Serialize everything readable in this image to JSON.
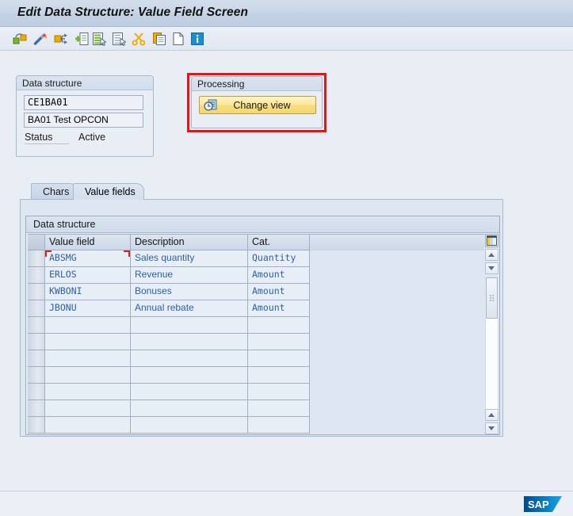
{
  "window": {
    "title": "Edit Data Structure: Value Field Screen"
  },
  "toolbar": {
    "buttons": [
      {
        "name": "structure-link-icon",
        "tooltip": "Structure"
      },
      {
        "name": "magic-wand-icon",
        "tooltip": "Generate"
      },
      {
        "name": "transport-arrow-icon",
        "tooltip": "Transport"
      },
      {
        "name": "insert-line-icon",
        "tooltip": "Insert line"
      },
      {
        "name": "select-list-icon",
        "tooltip": "Select"
      },
      {
        "name": "deselect-list-icon",
        "tooltip": "Deselect"
      },
      {
        "name": "cut-scissors-icon",
        "tooltip": "Cut"
      },
      {
        "name": "copy-icon",
        "tooltip": "Copy"
      },
      {
        "name": "new-document-icon",
        "tooltip": "Paste"
      },
      {
        "name": "info-icon",
        "tooltip": "Information"
      }
    ]
  },
  "data_structure_panel": {
    "header": "Data structure",
    "structure_name": "CE1BA01",
    "structure_description": "BA01 Test OPCON",
    "status_label": "Status",
    "status_value": "Active"
  },
  "processing_panel": {
    "header": "Processing",
    "change_view_label": "Change view",
    "highlight_color": "#ee1111"
  },
  "tabs": [
    {
      "label": "Chars",
      "active": false
    },
    {
      "label": "Value fields",
      "active": true
    }
  ],
  "table": {
    "panel_header": "Data structure",
    "columns": [
      "Value field",
      "Description",
      "Cat."
    ],
    "rows": [
      {
        "field": "ABSMG",
        "description": "Sales quantity",
        "category": "Quantity",
        "focused": true
      },
      {
        "field": "ERLOS",
        "description": "Revenue",
        "category": "Amount",
        "focused": false
      },
      {
        "field": "KWBONI",
        "description": "Bonuses",
        "category": "Amount",
        "focused": false
      },
      {
        "field": "JBONU",
        "description": "Annual rebate",
        "category": "Amount",
        "focused": false
      }
    ],
    "empty_row_count": 7,
    "text_color": "#2e5fa3"
  },
  "footer": {
    "logo": "SAP"
  }
}
